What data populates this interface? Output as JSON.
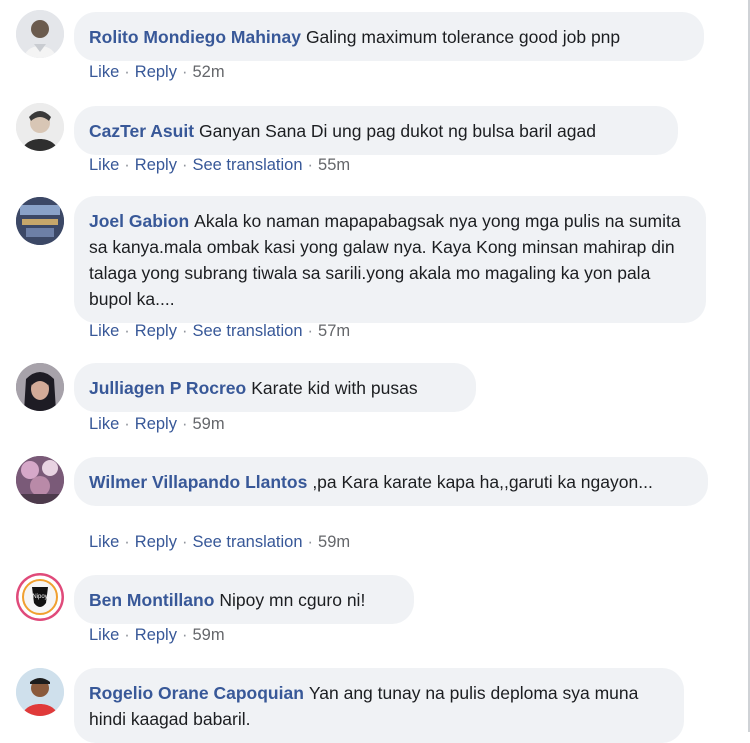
{
  "comments": [
    {
      "author": "Rolito Mondiego Mahinay",
      "text": "Galing maximum tolerance good job pnp",
      "actions": {
        "like": "Like",
        "reply": "Reply",
        "time": "52m"
      }
    },
    {
      "author": "CazTer Asuit",
      "text": "Ganyan Sana Di ung pag dukot ng bulsa baril agad",
      "actions": {
        "like": "Like",
        "reply": "Reply",
        "translate": "See translation",
        "time": "55m"
      }
    },
    {
      "author": "Joel Gabion",
      "text": "Akala ko naman mapapabagsak nya yong mga pulis na sumita sa kanya.mala ombak kasi yong galaw nya. Kaya Kong minsan mahirap din talaga yong subrang tiwala sa sarili.yong akala mo magaling ka yon pala bupol ka....",
      "actions": {
        "like": "Like",
        "reply": "Reply",
        "translate": "See translation",
        "time": "57m"
      }
    },
    {
      "author": "Julliagen P Rocreo",
      "text": "Karate kid with pusas",
      "actions": {
        "like": "Like",
        "reply": "Reply",
        "time": "59m"
      }
    },
    {
      "author": "Wilmer Villapando Llantos",
      "text": ",pa Kara karate kapa ha,,garuti ka ngayon...",
      "actions": {
        "like": "Like",
        "reply": "Reply",
        "translate": "See translation",
        "time": "59m"
      }
    },
    {
      "author": "Ben Montillano",
      "text": "Nipoy mn cguro ni!",
      "actions": {
        "like": "Like",
        "reply": "Reply",
        "time": "59m"
      }
    },
    {
      "author": "Rogelio Orane Capoquian",
      "text": "Yan ang tunay na pulis deploma sya muna hindi kaagad babaril."
    }
  ],
  "avatar_badge_text": "Nipoy",
  "colors": {
    "author": "#385898",
    "bubble": "#f0f2f5",
    "meta": "#65676b"
  }
}
